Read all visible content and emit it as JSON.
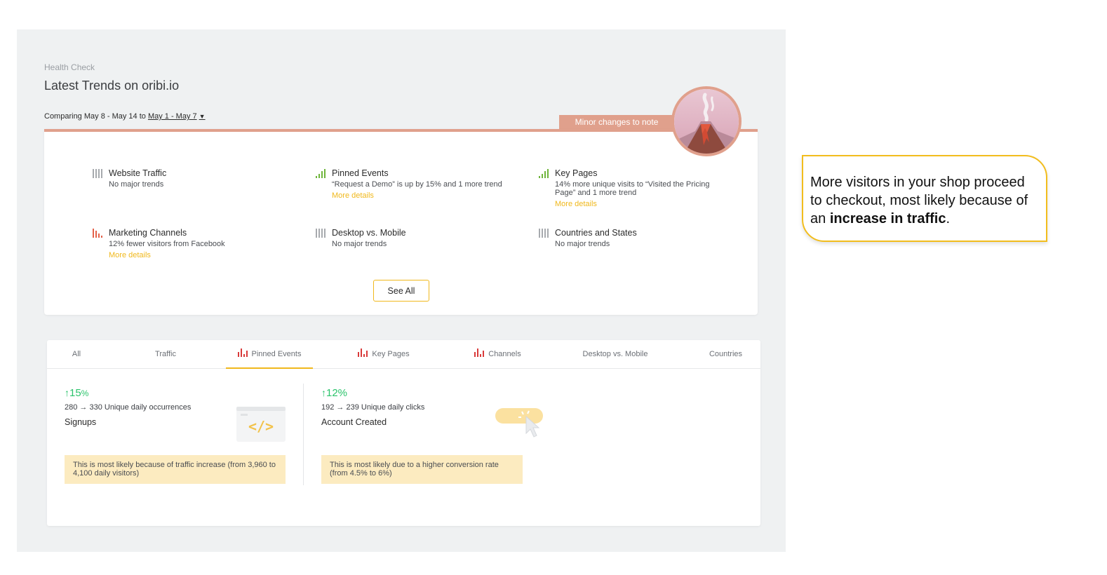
{
  "header": {
    "breadcrumb": "Health Check",
    "title": "Latest Trends on oribi.io",
    "comparing_prefix": "Comparing May 8 - May 14 to",
    "comparing_range": "May 1 - May 7",
    "status_badge": "Minor changes to note"
  },
  "trends": [
    {
      "name": "Website Traffic",
      "desc": "No major trends",
      "more": "",
      "icon": "neutral-bars-icon",
      "color": "#a7aaae"
    },
    {
      "name": "Pinned Events",
      "desc": "“Request a Demo” is up by 15% and 1 more trend",
      "more": "More details",
      "icon": "rising-bars-icon",
      "color": "#6fb53b"
    },
    {
      "name": "Key Pages",
      "desc": "14% more unique visits to “Visited the Pricing Page” and 1 more trend",
      "more": "More details",
      "icon": "rising-bars-icon",
      "color": "#6fb53b"
    },
    {
      "name": "Marketing Channels",
      "desc": "12% fewer visitors from Facebook",
      "more": "More details",
      "icon": "falling-bars-icon",
      "color": "#e3624a"
    },
    {
      "name": "Desktop vs. Mobile",
      "desc": "No major trends",
      "more": "",
      "icon": "neutral-bars-icon",
      "color": "#a7aaae"
    },
    {
      "name": "Countries and States",
      "desc": "No major trends",
      "more": "",
      "icon": "neutral-bars-icon",
      "color": "#a7aaae"
    }
  ],
  "see_all_label": "See All",
  "tabs": [
    {
      "label": "All"
    },
    {
      "label": "Traffic"
    },
    {
      "label": "Pinned Events",
      "icon": "chart-bars-icon",
      "active": true
    },
    {
      "label": "Key Pages",
      "icon": "chart-bars-icon"
    },
    {
      "label": "Channels",
      "icon": "chart-bars-icon"
    },
    {
      "label": "Desktop vs. Mobile"
    },
    {
      "label": "Countries"
    }
  ],
  "metrics": [
    {
      "arrow": "↑",
      "percent": "15",
      "pct_sign": "%",
      "sub": "280 → 330 Unique daily occurrences",
      "label": "Signups",
      "illustration": "code-window-icon",
      "note": "This is most likely because of traffic increase (from  3,960 to 4,100 daily visitors)"
    },
    {
      "arrow": "↑",
      "percent": "12%",
      "sub": "192 → 239 Unique daily clicks",
      "label": "Account Created",
      "illustration": "click-button-icon",
      "note": "This is most likely due to a higher conversion rate (from 4.5% to 6%)"
    }
  ],
  "callout": {
    "text_before": "More visitors in your shop proceed to checkout, most likely because of an ",
    "bold": "increase in traffic",
    "text_after": "."
  },
  "colors": {
    "accent": "#f0b81c",
    "badge": "#e0a08c",
    "positive": "#2bc36b",
    "negative": "#e3624a",
    "tab_icon": "#d93a3a"
  }
}
